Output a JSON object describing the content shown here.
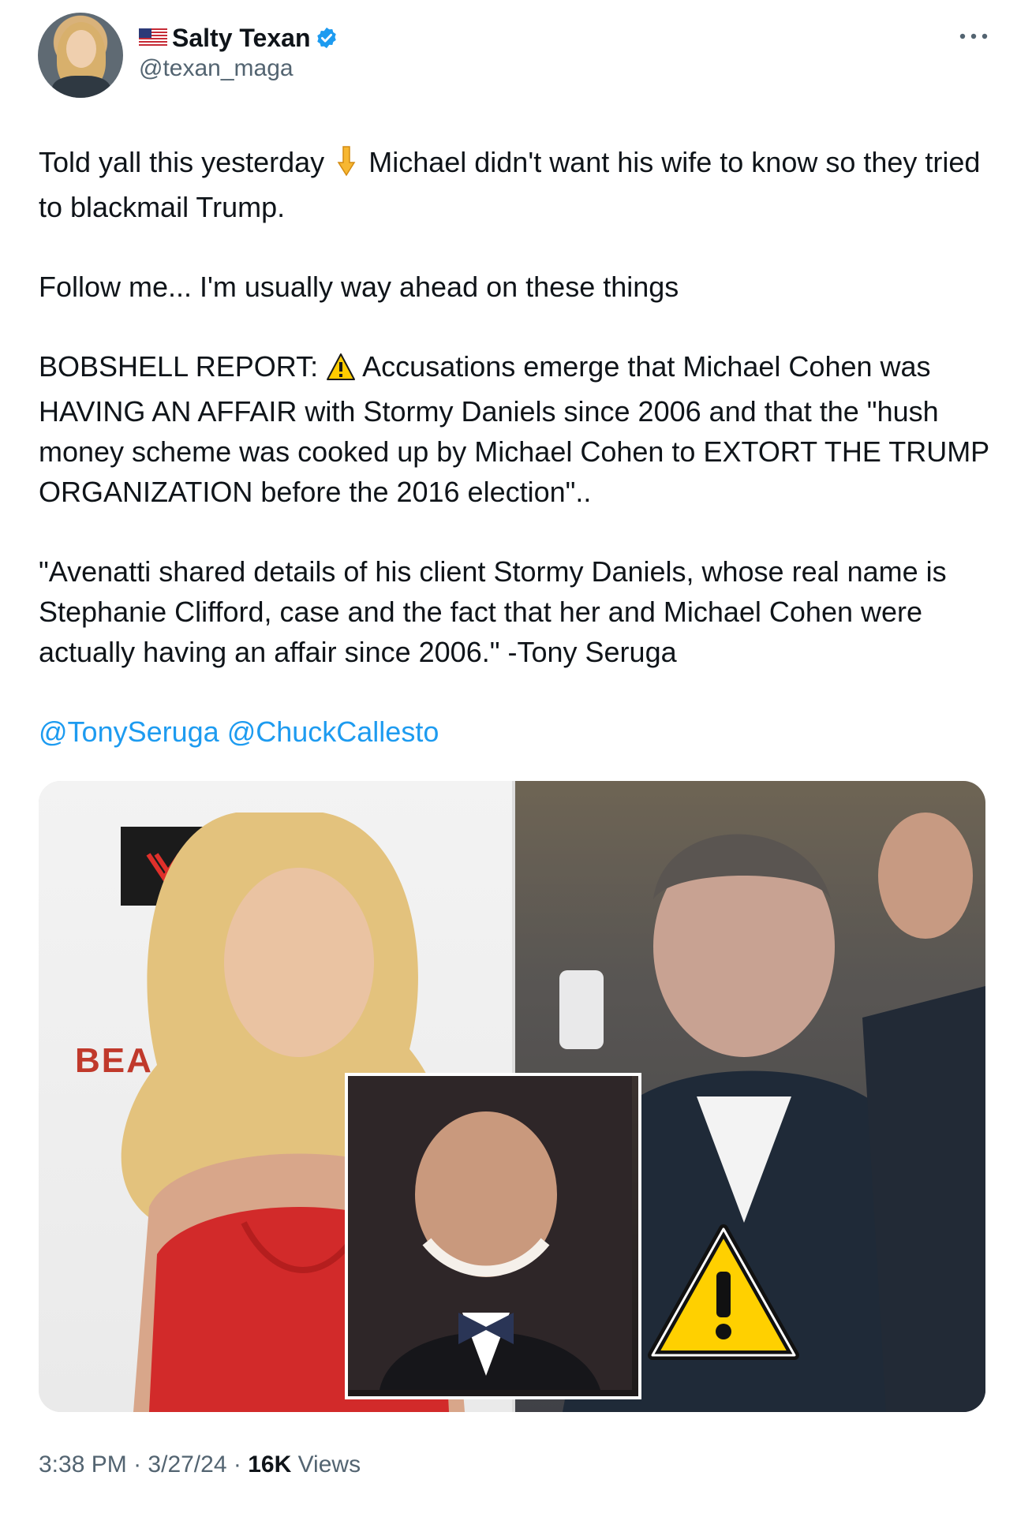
{
  "author": {
    "display_name": "Salty Texan",
    "handle": "@texan_maga"
  },
  "tweet": {
    "line1_a": "Told yall this yesterday",
    "line1_b": "Michael didn't want his wife to know so they tried to blackmail Trump.",
    "line2": "Follow me... I'm usually way ahead on these things",
    "line3_a": "BOBSHELL REPORT:",
    "line3_b": "Accusations emerge that Michael Cohen was HAVING AN AFFAIR with Stormy Daniels since 2006 and that the \"hush money scheme was cooked up by Michael Cohen to EXTORT THE TRUMP ORGANIZATION before the 2016 election\"..",
    "line4": "\"Avenatti shared details of his client Stormy Daniels, whose real name is Stephanie Clifford, case and the fact that her and Michael Cohen were actually having an affair since 2006.\" -Tony Seruga",
    "mention1": "@TonySeruga",
    "mention2": "@ChuckCallesto"
  },
  "media": {
    "sign_text": "BEA"
  },
  "meta": {
    "time": "3:38 PM",
    "date": "3/27/24",
    "views_count": "16K",
    "views_label": "Views",
    "separator": "·"
  },
  "colors": {
    "accent": "#1d9bf0",
    "text": "#0f1419",
    "secondary": "#536471"
  },
  "icons": {
    "flag": "us-flag-icon",
    "verified": "verified-badge-icon",
    "more": "more-options-icon",
    "pointing": "pointing-down-emoji",
    "warning": "warning-emoji"
  }
}
